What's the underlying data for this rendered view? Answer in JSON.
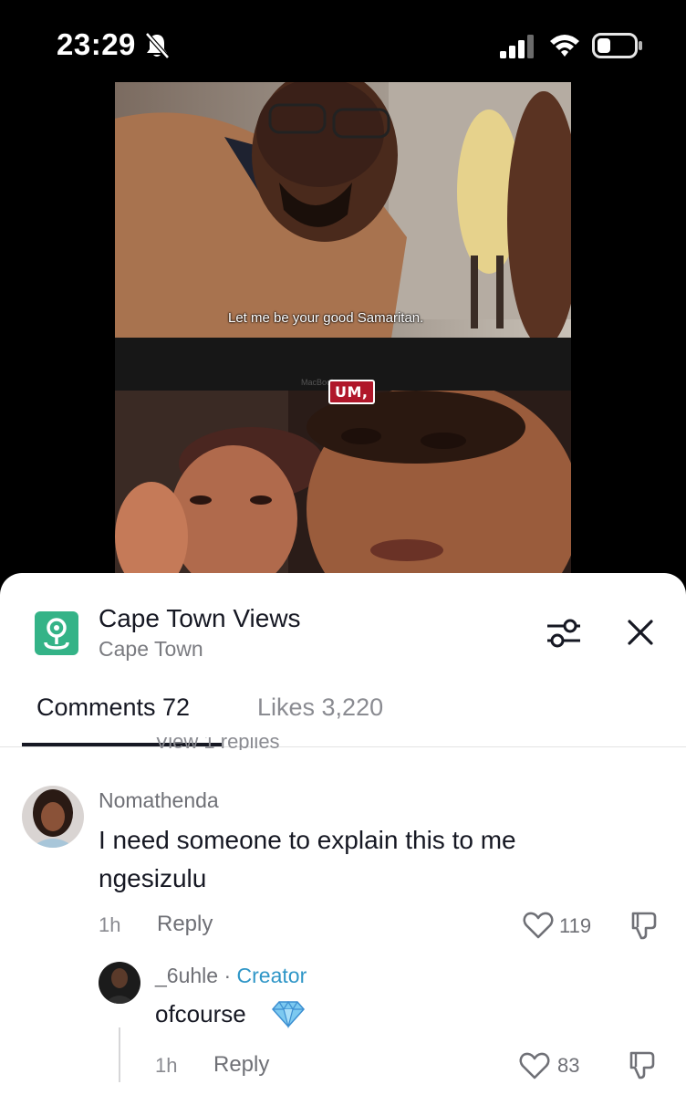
{
  "status_bar": {
    "time": "23:29"
  },
  "video": {
    "subtitle": "Let me be your good Samaritan.",
    "caption": "UM,",
    "watermark": "MacBook"
  },
  "sheet": {
    "place": {
      "title": "Cape Town Views",
      "subtitle": "Cape Town"
    },
    "tabs": [
      {
        "label": "Comments 72",
        "active": true
      },
      {
        "label": "Likes 3,220",
        "active": false
      }
    ],
    "view_replies_partial": "View 1 replies",
    "comments": [
      {
        "username": "Nomathenda",
        "text": "I need someone to explain this to me ngesizulu",
        "time": "1h",
        "reply_label": "Reply",
        "likes": "119",
        "replies": [
          {
            "username": "_6uhle",
            "separator": " · ",
            "badge": "Creator",
            "text": "ofcourse",
            "emoji_icon": "gem-icon",
            "time": "1h",
            "reply_label": "Reply",
            "likes": "83"
          }
        ]
      }
    ]
  },
  "colors": {
    "accent_creator": "#2f96c7",
    "place_icon_bg": "#34b387",
    "text_primary": "#161823",
    "text_secondary": "#8a8b91"
  }
}
